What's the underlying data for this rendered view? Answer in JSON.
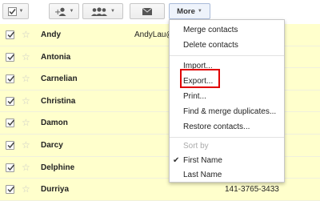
{
  "toolbar": {
    "more_label": "More"
  },
  "contacts": [
    {
      "name": "Andy",
      "email": "AndyLau@",
      "phone": ""
    },
    {
      "name": "Antonia",
      "email": "",
      "phone": ""
    },
    {
      "name": "Carnelian",
      "email": "",
      "phone": ""
    },
    {
      "name": "Christina",
      "email": "",
      "phone": ""
    },
    {
      "name": "Damon",
      "email": "",
      "phone": ""
    },
    {
      "name": "Darcy",
      "email": "",
      "phone": ""
    },
    {
      "name": "Delphine",
      "email": "",
      "phone": ""
    },
    {
      "name": "Durriya",
      "email": "",
      "phone": "141-3765-3433"
    }
  ],
  "more_menu": {
    "items": [
      "Merge contacts",
      "Delete contacts",
      "Import...",
      "Export...",
      "Print...",
      "Find & merge duplicates...",
      "Restore contacts..."
    ],
    "sort_by_label": "Sort by",
    "sort_options": [
      "First Name",
      "Last Name"
    ],
    "selected_sort": "First Name"
  },
  "colors": {
    "row_highlight": "#ffffcc",
    "export_outline": "#e00000"
  }
}
